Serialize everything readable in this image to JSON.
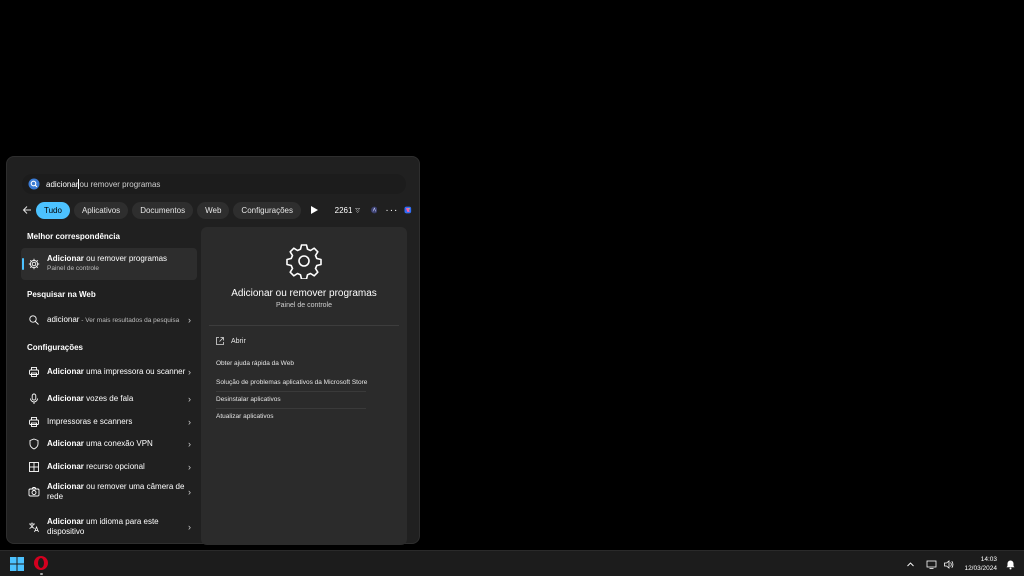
{
  "search": {
    "typed": "adicionar",
    "completion": " ou remover programas"
  },
  "filters": {
    "chips": [
      "Tudo",
      "Aplicativos",
      "Documentos",
      "Web",
      "Configurações"
    ],
    "active": "Tudo",
    "points": "2261"
  },
  "best_match": {
    "section": "Melhor correspondência",
    "bold": "Adicionar",
    "rest": " ou remover programas",
    "sub": "Painel de controle"
  },
  "web": {
    "section": "Pesquisar na Web",
    "query": "adicionar",
    "hint": " - Ver mais resultados da pesquisa"
  },
  "settings": {
    "section": "Configurações",
    "items": [
      {
        "bold": "Adicionar",
        "rest": " uma impressora ou scanner",
        "icon": "printer-icon"
      },
      {
        "bold": "Adicionar",
        "rest": " vozes de fala",
        "icon": "microphone-icon"
      },
      {
        "bold": "",
        "rest": "Impressoras e scanners",
        "icon": "printer-icon"
      },
      {
        "bold": "Adicionar",
        "rest": " uma conexão VPN",
        "icon": "shield-icon"
      },
      {
        "bold": "Adicionar",
        "rest": " recurso opcional",
        "icon": "grid-icon"
      },
      {
        "bold": "Adicionar",
        "rest": " ou remover uma câmera de rede",
        "icon": "camera-icon"
      },
      {
        "bold": "Adicionar",
        "rest": " um idioma para este dispositivo",
        "icon": "language-icon"
      }
    ]
  },
  "detail": {
    "title": "Adicionar ou remover programas",
    "subtitle": "Painel de controle",
    "open": "Abrir",
    "links": [
      "Obter ajuda rápida da Web",
      "Solução de problemas aplicativos da Microsoft Store",
      "Desinstalar aplicativos",
      "Atualizar aplicativos"
    ]
  },
  "taskbar": {
    "time": "14:03",
    "date": "12/03/2024"
  },
  "colors": {
    "accent": "#4cc2ff",
    "panel": "#202020",
    "pane": "#2b2b2b"
  }
}
